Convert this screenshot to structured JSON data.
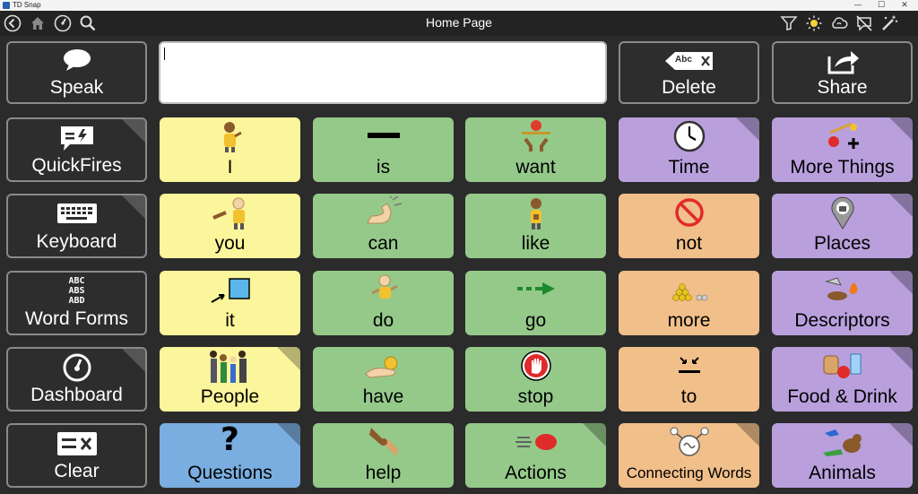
{
  "window": {
    "app_title": "TD Snap",
    "min": "—",
    "max": "☐",
    "close": "✕"
  },
  "toolbar": {
    "page_title": "Home Page"
  },
  "message_bar": {
    "text": ""
  },
  "top_buttons": {
    "speak": "Speak",
    "delete": "Delete",
    "delete_icon_text": "Abc",
    "share": "Share"
  },
  "side_buttons": {
    "quickfires": "QuickFires",
    "keyboard": "Keyboard",
    "word_forms": "Word Forms",
    "word_forms_icon": [
      "ABC",
      "ABS",
      "ABD"
    ],
    "dashboard": "Dashboard",
    "clear": "Clear"
  },
  "grid": {
    "i": "I",
    "is": "is",
    "want": "want",
    "time": "Time",
    "more_things": "More Things",
    "you": "you",
    "can": "can",
    "like": "like",
    "not": "not",
    "places": "Places",
    "it": "it",
    "do": "do",
    "go": "go",
    "more": "more",
    "descriptors": "Descriptors",
    "people": "People",
    "have": "have",
    "stop": "stop",
    "to": "to",
    "food_drink": "Food & Drink",
    "questions": "Questions",
    "questions_symbol": "?",
    "help": "help",
    "actions": "Actions",
    "connecting_words": "Connecting Words",
    "animals": "Animals"
  },
  "colors": {
    "pronoun": "#fbf59b",
    "verb": "#95c98a",
    "category": "#b9a0dd",
    "small_word": "#f1bf8a",
    "question": "#7aaee0",
    "dark": "#2d2d2d"
  }
}
